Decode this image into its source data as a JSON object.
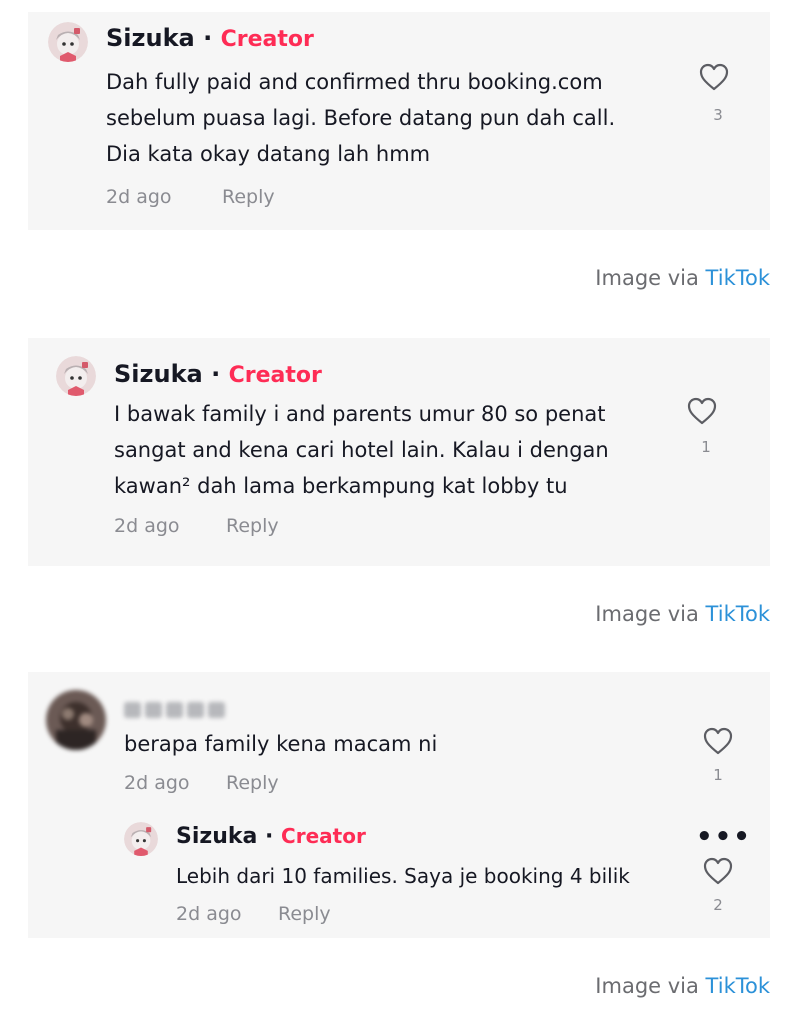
{
  "comments": [
    {
      "author": "Sizuka",
      "badge": "Creator",
      "separator": "·",
      "lines": [
        "Dah fully paid and confirmed thru booking.com",
        "sebelum puasa lagi. Before datang pun dah call.",
        "Dia kata okay datang lah hmm"
      ],
      "time": "2d ago",
      "reply_label": "Reply",
      "likes": "3"
    },
    {
      "author": "Sizuka",
      "badge": "Creator",
      "separator": "·",
      "lines": [
        "I bawak family i and parents umur 80 so penat",
        "sangat and kena cari hotel lain. Kalau i dengan",
        "kawan² dah lama berkampung kat lobby tu"
      ],
      "time": "2d ago",
      "reply_label": "Reply",
      "likes": "1"
    },
    {
      "author": "",
      "lines": [
        "berapa family kena macam ni"
      ],
      "time": "2d ago",
      "reply_label": "Reply",
      "likes": "1",
      "reply": {
        "author": "Sizuka",
        "badge": "Creator",
        "separator": "·",
        "lines": [
          "Lebih dari 10 families. Saya je booking 4 bilik"
        ],
        "time": "2d ago",
        "reply_label": "Reply",
        "likes": "2",
        "more": "•••"
      }
    }
  ],
  "captions": [
    {
      "prefix": "Image via ",
      "source": "TikTok"
    },
    {
      "prefix": "Image via ",
      "source": "TikTok"
    },
    {
      "prefix": "Image via ",
      "source": "TikTok"
    }
  ],
  "icons": {
    "like": "heart-outline-icon",
    "more": "more-horizontal-icon"
  },
  "colors": {
    "badge": "#fe2c55",
    "link": "#2c91d8",
    "card": "#f6f6f6",
    "meta": "#8a8b91"
  }
}
